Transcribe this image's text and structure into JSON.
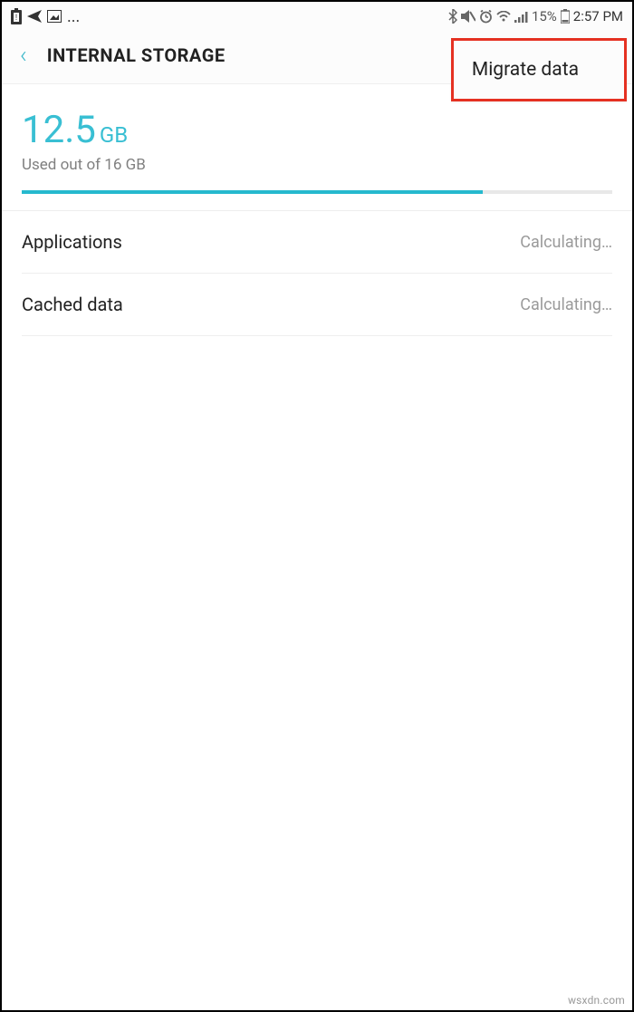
{
  "status_bar": {
    "battery_percent": "15%",
    "clock": "2:57 PM",
    "ellipsis": "..."
  },
  "header": {
    "title": "INTERNAL STORAGE",
    "menu_item": "Migrate data"
  },
  "storage": {
    "used_value": "12.5",
    "used_unit": "GB",
    "subtext": "Used out of 16 GB",
    "percent_fill": 78
  },
  "rows": [
    {
      "label": "Applications",
      "value": "Calculating…"
    },
    {
      "label": "Cached data",
      "value": "Calculating…"
    }
  ],
  "watermark": "wsxdn.com"
}
